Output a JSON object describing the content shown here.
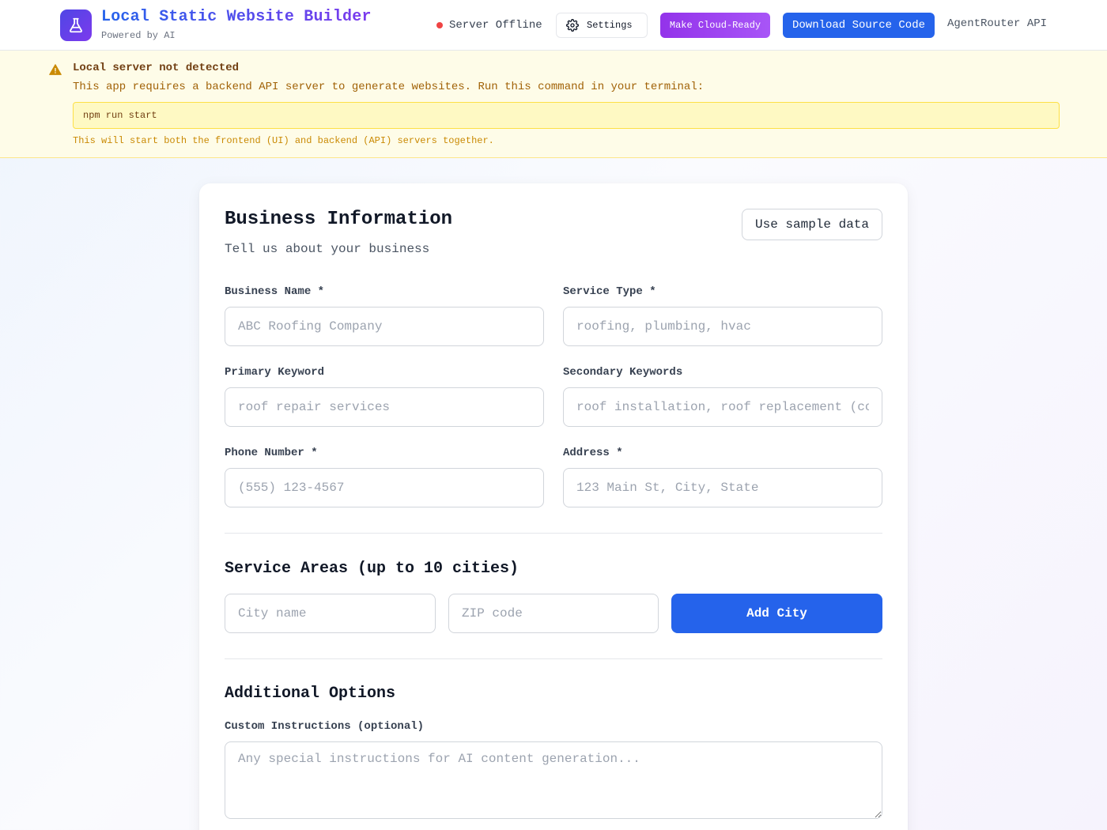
{
  "header": {
    "app_title": "Local Static Website Builder",
    "app_subtitle": "Powered by AI",
    "logo_icon": "flask-icon",
    "status_text": "Server Offline",
    "status_color": "#ef4444",
    "settings_label": "Settings",
    "cloud_label": "Make Cloud-Ready",
    "download_label": "Download Source Code",
    "api_label": "AgentRouter API"
  },
  "banner": {
    "icon": "warning-icon",
    "title": "Local server not detected",
    "message": "This app requires a backend API server to generate websites. Run this command in your terminal:",
    "command": "npm run start",
    "note": "This will start both the frontend (UI) and backend (API) servers together."
  },
  "form": {
    "title": "Business Information",
    "subtitle": "Tell us about your business",
    "sample_button": "Use sample data",
    "fields": {
      "business_name": {
        "label": "Business Name *",
        "placeholder": "ABC Roofing Company",
        "value": ""
      },
      "service_type": {
        "label": "Service Type *",
        "placeholder": "roofing, plumbing, hvac",
        "value": ""
      },
      "primary_keyword": {
        "label": "Primary Keyword",
        "placeholder": "roof repair services",
        "value": ""
      },
      "secondary_keywords": {
        "label": "Secondary Keywords",
        "placeholder": "roof installation, roof replacement (comma separated)",
        "value": ""
      },
      "phone": {
        "label": "Phone Number *",
        "placeholder": "(555) 123-4567",
        "value": ""
      },
      "address": {
        "label": "Address *",
        "placeholder": "123 Main St, City, State",
        "value": ""
      }
    },
    "service_areas": {
      "title": "Service Areas (up to 10 cities)",
      "city_placeholder": "City name",
      "zip_placeholder": "ZIP code",
      "add_button": "Add City"
    },
    "additional": {
      "title": "Additional Options",
      "custom_label": "Custom Instructions (optional)",
      "custom_placeholder": "Any special instructions for AI content generation..."
    }
  },
  "colors": {
    "primary": "#2563eb",
    "purple": "#9333ea",
    "warning_bg": "#fefce8",
    "warning_text": "#a16207"
  }
}
